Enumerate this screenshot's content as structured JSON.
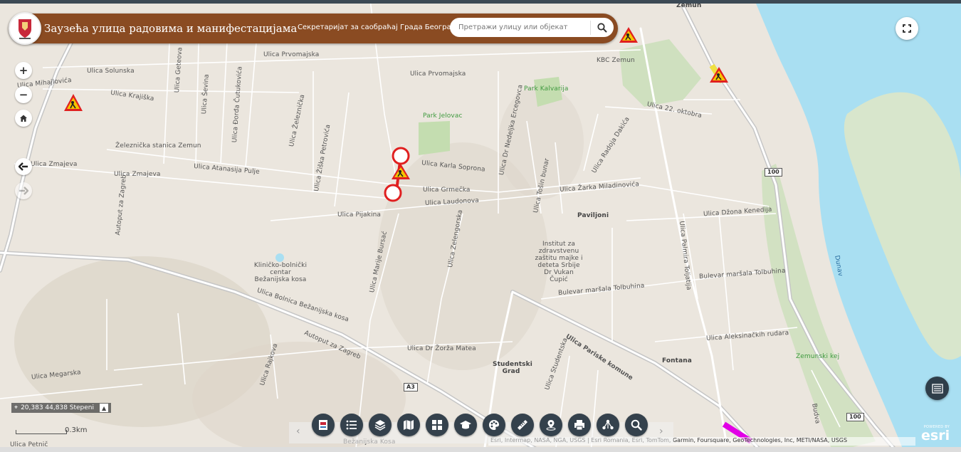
{
  "header": {
    "title": "Заузећа улица радовима и манифестацијама",
    "subtitle": "Секретаријат за саобраћај Града Београда",
    "search_placeholder": "Претражи улицу или објекат",
    "accent": "#8a4b22"
  },
  "controls": {
    "zoom_in": "+",
    "zoom_out": "−",
    "home_icon": "home-icon",
    "back_icon": "arrow-left-icon",
    "forward_icon": "arrow-right-icon",
    "fullscreen_icon": "fullscreen-icon",
    "list_icon": "list-icon"
  },
  "status": {
    "coordinates": "20,383 44,838 Stepeni",
    "scale": "0.3km"
  },
  "toolbar": {
    "prev": "‹",
    "next": "›",
    "buttons": [
      "legend-icon",
      "list-icon",
      "layers-icon",
      "basemap-icon",
      "grid-icon",
      "education-icon",
      "palette-icon",
      "measure-icon",
      "location-icon",
      "print-icon",
      "share-icon",
      "search-icon"
    ]
  },
  "attribution": "Esri, Intermap, NASA, NGA, USGS | Esri Romania, Esri, TomTom, Garmin, Foursquare, GeoTechnologies, Inc, METI/NASA, USGS",
  "esri": {
    "powered": "POWERED BY",
    "name": "esri"
  },
  "map_labels": {
    "zemun": "Zemun",
    "kbc": "KBC Zemun",
    "park_kalvarija": "Park Kalvarija",
    "park_jelovac": "Park Jelovac",
    "solunska": "Ulica Solunska",
    "krajiska": "Ulica Krajiška",
    "mihajlovica": "Ulica Mihajlovića",
    "prvomajska1": "Ulica Prvomajska",
    "prvomajska2": "Ulica Prvomajska",
    "getova": "Ulica Geteova",
    "sevina": "Ulica Ševina",
    "djordja": "Ulica Đorđa Čutukovića",
    "zeleznicka": "Ulica Železnička",
    "zuska": "Ulica Žiška Petrovića",
    "stanica": "Železnička stanica Zemun",
    "zmajeva1": "Ulica Zmajeva",
    "zmajeva2": "Ulica Zmajeva",
    "atanasija": "Ulica Atanasija Pulje",
    "karla": "Ulica Karla Soprona",
    "grmecka": "Ulica Grmečka",
    "laudonova": "Ulica Laudonova",
    "pijakina": "Ulica Pijakina",
    "nedeljka": "Ulica Dr Nedeljka Ercegovca",
    "radoja": "Ulica Radoja Dakića",
    "tosin": "Ulica Tošin bunar",
    "zarka": "Ulica Žarka Miladinovića",
    "dzona": "Ulica Džona Kenedija",
    "oktobra": "Ulica 22. oktobra",
    "paviljoni": "Paviljoni",
    "institut": "Institut za zdravstvenu zaštitu majke i deteta Srbije Dr Vukan Čupić",
    "palmira": "Ulica Palmira Toljatija",
    "tolbuhina1": "Bulevar maršala Tolbuhina",
    "tolbuhina2": "Bulevar maršala Tolbuhina",
    "zelengorska": "Ulica Zelengorska",
    "marije": "Ulica Marije Bursać",
    "bolnica": "Ulica Bolnica Bežanijska kosa",
    "klinicko": "Kliničko-bolnički centar Bežanijska kosa",
    "pariske": "Ulica Pariske komune",
    "aleksinackih": "Ulica Aleksinačkih rudara",
    "fontana": "Fontana",
    "studentski": "Studentski Grad",
    "studentska": "Ulica Studentska",
    "tosin2": "Ulica Dr Žorža Mateа",
    "autoput1": "Autoput za Zagreb",
    "autoput2": "Autoput za Zagreb",
    "megarska": "Ulica Megarska",
    "rajkova": "Ulica Rajkova",
    "petnica": "Ulica Petnič",
    "dunav": "Dunav",
    "zemunski_kej": "Zemunski kej",
    "budva": "Budva",
    "bezanijska": "Bežanijska Kosa",
    "shield_100a": "100",
    "shield_100b": "100",
    "shield_a3": "A3"
  }
}
